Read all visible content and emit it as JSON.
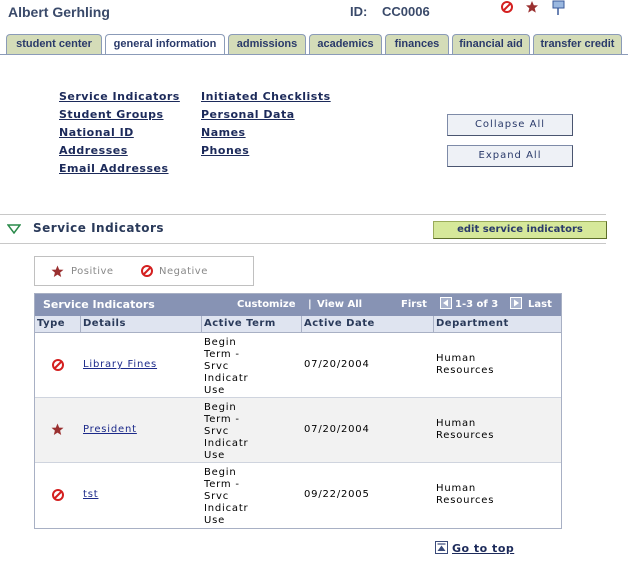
{
  "header": {
    "student_name": "Albert Gerhling",
    "id_label": "ID:",
    "id_value": "CC0006",
    "icons": [
      "negative-indicator-icon",
      "positive-indicator-icon",
      "flag-icon"
    ]
  },
  "tabs": [
    {
      "label": "student center",
      "active": false
    },
    {
      "label": "general information",
      "active": true
    },
    {
      "label": "admissions",
      "active": false
    },
    {
      "label": "academics",
      "active": false
    },
    {
      "label": "finances",
      "active": false
    },
    {
      "label": "financial aid",
      "active": false
    },
    {
      "label": "transfer credit",
      "active": false
    }
  ],
  "nav_links": {
    "col1": [
      "Service Indicators",
      "Student Groups",
      "National ID",
      "Addresses",
      "Email Addresses"
    ],
    "col2": [
      "Initiated Checklists",
      "Personal Data",
      "Names",
      "Phones"
    ]
  },
  "buttons": {
    "collapse_all": "Collapse All",
    "expand_all": "Expand All",
    "edit_service_indicators": "edit service indicators"
  },
  "section": {
    "title": "Service Indicators"
  },
  "legend": {
    "positive": "Positive",
    "negative": "Negative"
  },
  "grid": {
    "title": "Service Indicators",
    "customize": "Customize",
    "separator": "|",
    "view_all": "View All",
    "first": "First",
    "range": "1-3 of 3",
    "last": "Last",
    "columns": [
      "Type",
      "Details",
      "Active Term",
      "Active Date",
      "Department"
    ],
    "rows": [
      {
        "type": "negative",
        "details": "Library Fines",
        "active_term": "Begin\nTerm -\nSrvc\nIndicatr\nUse",
        "active_date": "07/20/2004",
        "department": "Human Resources"
      },
      {
        "type": "positive",
        "details": "President",
        "active_term": "Begin\nTerm -\nSrvc\nIndicatr\nUse",
        "active_date": "07/20/2004",
        "department": "Human Resources"
      },
      {
        "type": "negative",
        "details": "tst",
        "active_term": "Begin\nTerm -\nSrvc\nIndicatr\nUse",
        "active_date": "09/22/2005",
        "department": "Human Resources"
      }
    ]
  },
  "footer": {
    "go_to_top": "Go to top"
  },
  "colors": {
    "tab_bg": "#d4dcb8",
    "grid_header": "#8793b4",
    "edit_button": "#d6e89a",
    "negative_red": "#d42020",
    "positive_star": "#9a3030"
  }
}
